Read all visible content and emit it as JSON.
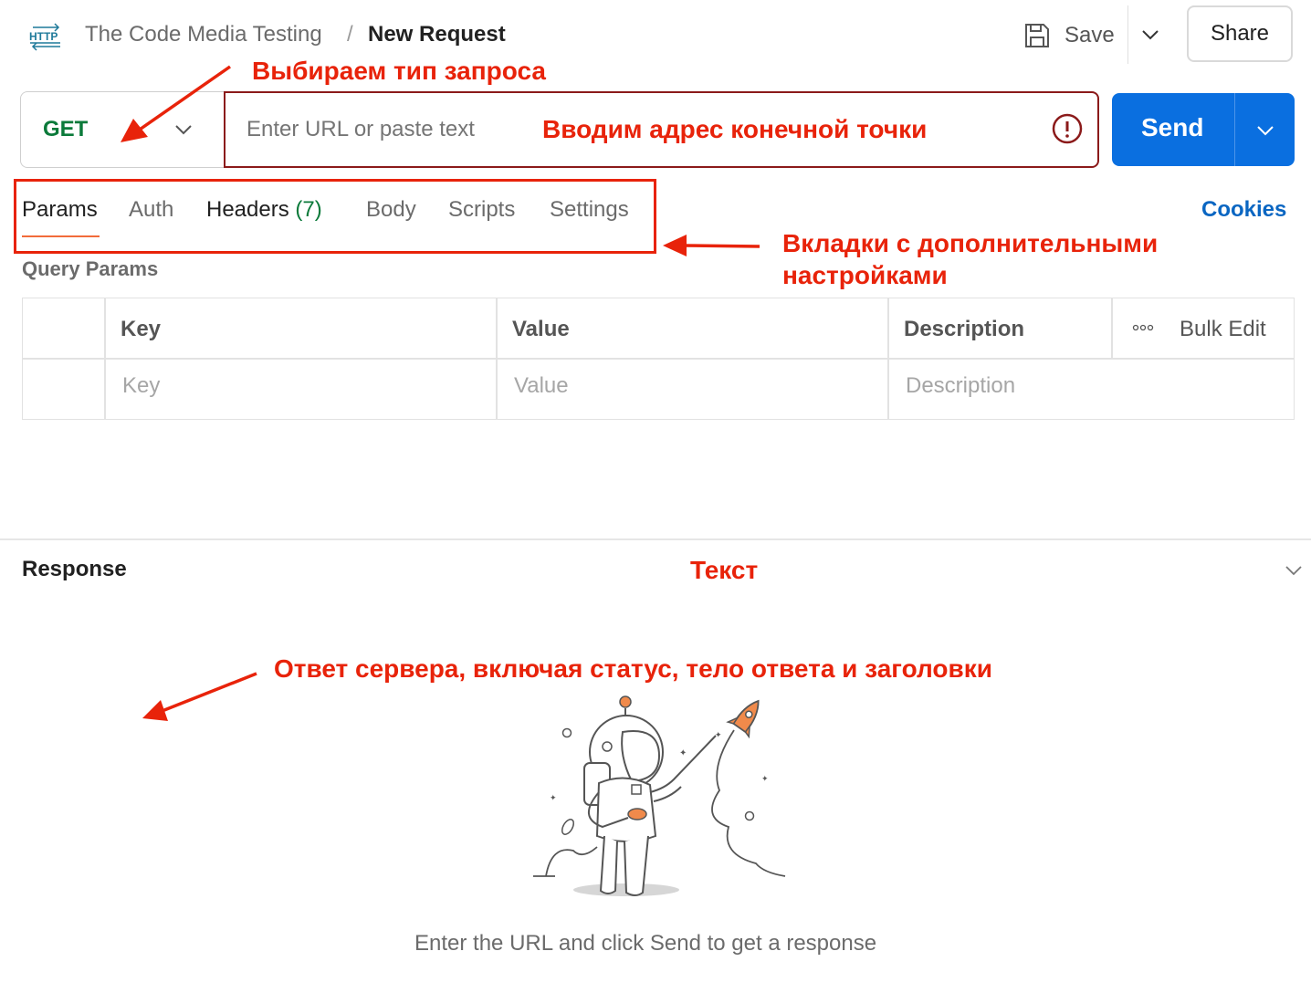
{
  "header": {
    "breadcrumb_parent": "The Code Media Testing",
    "breadcrumb_separator": "/",
    "breadcrumb_current": "New Request",
    "http_icon_text": "HTTP",
    "save_label": "Save",
    "share_label": "Share"
  },
  "request": {
    "method": "GET",
    "url_placeholder": "Enter URL or paste text",
    "send_label": "Send"
  },
  "tabs": {
    "items": [
      {
        "label": "Params"
      },
      {
        "label": "Auth"
      },
      {
        "label": "Headers"
      },
      {
        "label": "Body"
      },
      {
        "label": "Scripts"
      },
      {
        "label": "Settings"
      }
    ],
    "headers_count": "(7)",
    "cookies_label": "Cookies"
  },
  "params": {
    "title": "Query Params",
    "columns": [
      "Key",
      "Value",
      "Description"
    ],
    "bulk_edit_label": "Bulk Edit",
    "placeholders": {
      "key": "Key",
      "value": "Value",
      "description": "Description"
    }
  },
  "response": {
    "title": "Response",
    "empty_message": "Enter the URL and click Send to get a response"
  },
  "annotations": {
    "method": "Выбираем тип запроса",
    "url": "Вводим адрес конечной точки",
    "tabs_line1": "Вкладки с дополнительными",
    "tabs_line2": "настройками",
    "text": "Текст",
    "response": "Ответ сервера, включая статус, тело ответа и заголовки"
  },
  "icons": {
    "save": "save-icon",
    "chevron": "chevron-down-icon",
    "error": "error-icon",
    "more": "more-dots-icon"
  },
  "colors": {
    "method_green": "#0b7a3a",
    "send_blue": "#0a6fe0",
    "annotation_red": "#e8230a",
    "cookies_blue": "#0a66c2",
    "active_tab_underline": "#f26b3a"
  }
}
